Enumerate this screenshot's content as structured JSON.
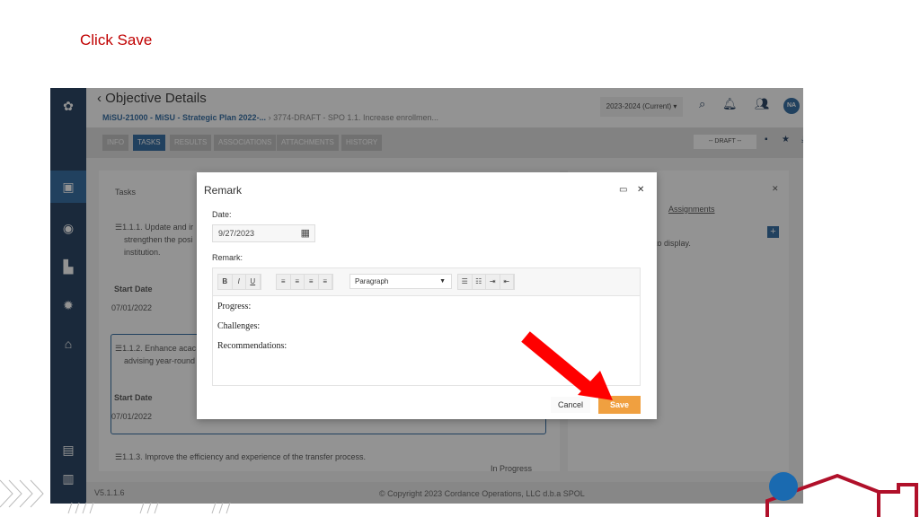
{
  "caption": "Click Save",
  "app": {
    "title": "Objective Details",
    "breadcrumb": {
      "plan": "MiSU-21000 - MiSU - Strategic Plan 2022-...",
      "objective": "3774-DRAFT - SPO 1.1. Increase enrollmen..."
    },
    "year_select": "2023-2024 (Current) ▾",
    "avatar": "NA",
    "tabs": [
      "INFO",
      "TASKS",
      "RESULTS",
      "ASSOCIATIONS",
      "ATTACHMENTS",
      "HISTORY"
    ],
    "active_tab": "TASKS",
    "status_select": "-- DRAFT --",
    "tasks_header": "Tasks",
    "tasks": [
      {
        "text": "☰1.1.1. Update and ir",
        "line2": "strengthen the posi",
        "line3": "institution.",
        "start_label": "Start Date",
        "start": "07/01/2022"
      },
      {
        "text": "☰1.1.2. Enhance acac",
        "line2": "advising year-round",
        "start_label": "Start Date",
        "start": "07/01/2022"
      },
      {
        "text": "☰1.1.3. Improve the efficiency and experience of the transfer process.",
        "status": "In Progress"
      }
    ],
    "right_panel": {
      "link": "Assignments",
      "empty": "to display."
    },
    "version": "V5.1.1.6",
    "copyright": "© Copyright 2023 Cordance Operations, LLC d.b.a SPOL"
  },
  "modal": {
    "title": "Remark",
    "date_label": "Date:",
    "date_value": "9/27/2023",
    "remark_label": "Remark:",
    "format_select": "Paragraph",
    "content": [
      "Progress:",
      "Challenges:",
      "Recommendations:"
    ],
    "cancel": "Cancel",
    "save": "Save"
  },
  "colors": {
    "accent": "#1a5a96",
    "save": "#f0a040",
    "arrow": "#ff0000",
    "caption": "#c00000"
  }
}
